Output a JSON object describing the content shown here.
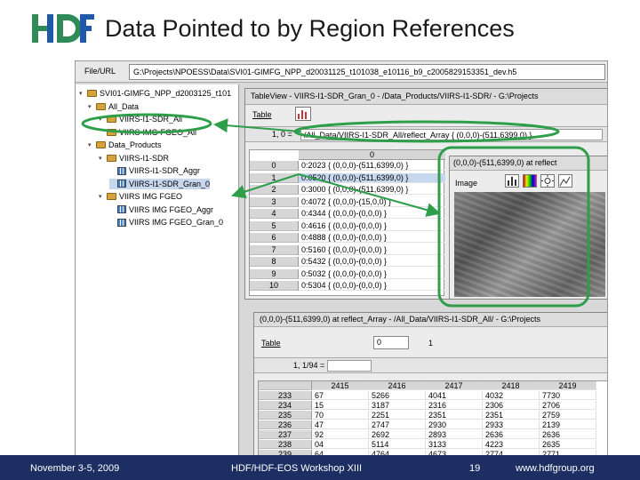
{
  "slide": {
    "title": "Data Pointed to by Region References",
    "logo_text": "HDF"
  },
  "address_bar": {
    "label": "File/URL",
    "value": "G:\\Projects\\NPOESS\\Data\\SVI01-GIMFG_NPP_d20031125_t101038_e10116_b9_c2005829153351_dev.h5"
  },
  "tree": {
    "items": [
      {
        "label": "SVI01-GIMFG_NPP_d2003125_t101",
        "type": "file"
      },
      {
        "label": "All_Data",
        "type": "folder"
      },
      {
        "label": "VIIRS-I1-SDR_All",
        "type": "folder"
      },
      {
        "label": "VIIRS-IMG-FGEO_All",
        "type": "folder"
      },
      {
        "label": "Data_Products",
        "type": "folder"
      },
      {
        "label": "VIIRS-I1-SDR",
        "type": "folder"
      },
      {
        "label": "VIIRS-I1-SDR_Aggr",
        "type": "dataset"
      },
      {
        "label": "VIIRS-I1-SDR_Gran_0",
        "type": "dataset"
      },
      {
        "label": "VIIRS IMG FGEO",
        "type": "folder"
      },
      {
        "label": "VIIRS IMG FGEO_Aggr",
        "type": "dataset"
      },
      {
        "label": "VIIRS IMG FGEO_Gran_0",
        "type": "dataset"
      }
    ]
  },
  "table_view": {
    "title": "TableView - VIIRS-I1-SDR_Gran_0 - /Data_Products/VIIRS-I1-SDR/ - G:\\Projects",
    "menu": "Table",
    "cell_ref": "1, 0 =",
    "cell_value": "/All_Data/VIIRS-I1-SDR_All/reflect_Array { (0,0,0)-(511,6399,0) }",
    "column_header": "0",
    "rows": [
      {
        "index": "0",
        "value": "0:2023 { (0,0,0)-(511,6399,0) }"
      },
      {
        "index": "1",
        "value": "0:0520 { (0,0,0)-(511,6399,0) }"
      },
      {
        "index": "2",
        "value": "0:3000 { (0,0,0)-(511,6399,0) }"
      },
      {
        "index": "3",
        "value": "0:4072 { (0,0,0)-(15,0,0) }"
      },
      {
        "index": "4",
        "value": "0:4344 { (0,0,0)-(0,0,0) }"
      },
      {
        "index": "5",
        "value": "0:4616 { (0,0,0)-(0,0,0) }"
      },
      {
        "index": "6",
        "value": "0:4888 { (0,0,0)-(0,0,0) }"
      },
      {
        "index": "7",
        "value": "0:5160 { (0,0,0)-(0,0,0) }"
      },
      {
        "index": "8",
        "value": "0:5432 { (0,0,0)-(0,0,0) }"
      },
      {
        "index": "9",
        "value": "0:5032 { (0,0,0)-(0,0,0) }"
      },
      {
        "index": "10",
        "value": "0:5304 { (0,0,0)-(0,0,0) }"
      }
    ]
  },
  "image_view": {
    "title": "(0,0,0)-(511,6399,0) at reflect",
    "menu": "Image"
  },
  "table_view2": {
    "title": "(0,0,0)-(511,6399,0) at reflect_Array - /All_Data/VIIRS-I1-SDR_All/ - G:\\Projects",
    "menu": "Table",
    "input_value": "0",
    "number": "1",
    "cell_ref": "1, 1/94 =",
    "columns": [
      "2415",
      "2416",
      "2417",
      "2418",
      "2419"
    ],
    "rows": [
      {
        "index": "233",
        "values": [
          "67",
          "5266",
          "4041",
          "4032",
          "7730"
        ]
      },
      {
        "index": "234",
        "values": [
          "15",
          "3187",
          "2316",
          "2306",
          "2706"
        ]
      },
      {
        "index": "235",
        "values": [
          "70",
          "2251",
          "2351",
          "2351",
          "2759"
        ]
      },
      {
        "index": "236",
        "values": [
          "47",
          "2747",
          "2930",
          "2933",
          "2139"
        ]
      },
      {
        "index": "237",
        "values": [
          "92",
          "2692",
          "2893",
          "2636",
          "2636"
        ]
      },
      {
        "index": "238",
        "values": [
          "04",
          "5114",
          "3133",
          "4223",
          "2635"
        ]
      },
      {
        "index": "239",
        "values": [
          "64",
          "4764",
          "4673",
          "2774",
          "2771"
        ]
      }
    ]
  },
  "footer": {
    "date": "November 3-5, 2009",
    "workshop": "HDF/HDF-EOS Workshop XIII",
    "page": "19",
    "url": "www.hdfgroup.org"
  },
  "colors": {
    "annotation": "#2e9e4a",
    "footer_bg": "#1d2e63",
    "logo_green": "#2e8b57",
    "logo_blue": "#1e5aa8"
  }
}
